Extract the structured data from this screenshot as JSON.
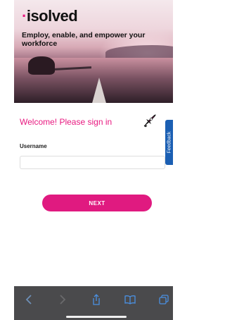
{
  "brand": {
    "name": "isolved",
    "tagline": "Employ, enable, and empower your workforce"
  },
  "login": {
    "welcome": "Welcome! Please sign in",
    "username_label": "Username",
    "username_value": "",
    "next_label": "NEXT"
  },
  "feedback": {
    "label": "Feedback"
  },
  "colors": {
    "accent": "#e01a80",
    "feedback": "#1b5fb3",
    "toolbar": "#4a4a4c"
  },
  "toolbar": {
    "icons": [
      "back-icon",
      "forward-icon",
      "share-icon",
      "bookmarks-icon",
      "tabs-icon"
    ]
  }
}
